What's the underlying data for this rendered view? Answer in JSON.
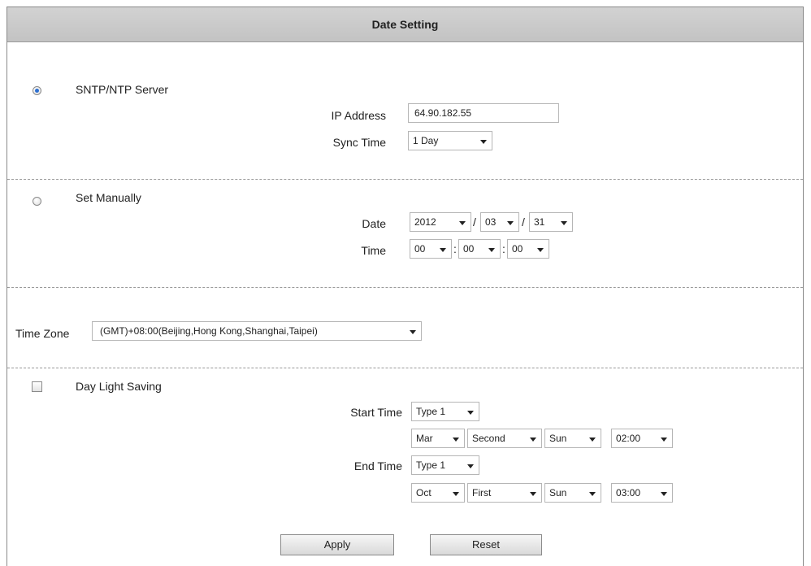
{
  "header": {
    "title": "Date Setting"
  },
  "sntp": {
    "option_label": "SNTP/NTP Server",
    "ip_label": "IP Address",
    "ip_value": "64.90.182.55",
    "sync_label": "Sync Time",
    "sync_value": "1 Day"
  },
  "manual": {
    "option_label": "Set Manually",
    "date_label": "Date",
    "year": "2012",
    "month": "03",
    "day": "31",
    "date_sep": "/",
    "time_label": "Time",
    "hour": "00",
    "minute": "00",
    "second": "00",
    "time_sep": ":"
  },
  "timezone": {
    "label": "Time Zone",
    "value": "(GMT)+08:00(Beijing,Hong Kong,Shanghai,Taipei)"
  },
  "dst": {
    "checkbox_label": "Day Light Saving",
    "start_label": "Start Time",
    "start_type": "Type 1",
    "start_month": "Mar",
    "start_week": "Second",
    "start_day": "Sun",
    "start_time": "02:00",
    "end_label": "End Time",
    "end_type": "Type 1",
    "end_month": "Oct",
    "end_week": "First",
    "end_day": "Sun",
    "end_time": "03:00"
  },
  "buttons": {
    "apply": "Apply",
    "reset": "Reset"
  },
  "state": {
    "sntp_selected": true,
    "manual_selected": false,
    "dst_checked": false
  },
  "colors": {
    "header_bg": "#c8c8c8",
    "radio_selected": "#2c6fd1",
    "divider": "#9a9a9a"
  }
}
